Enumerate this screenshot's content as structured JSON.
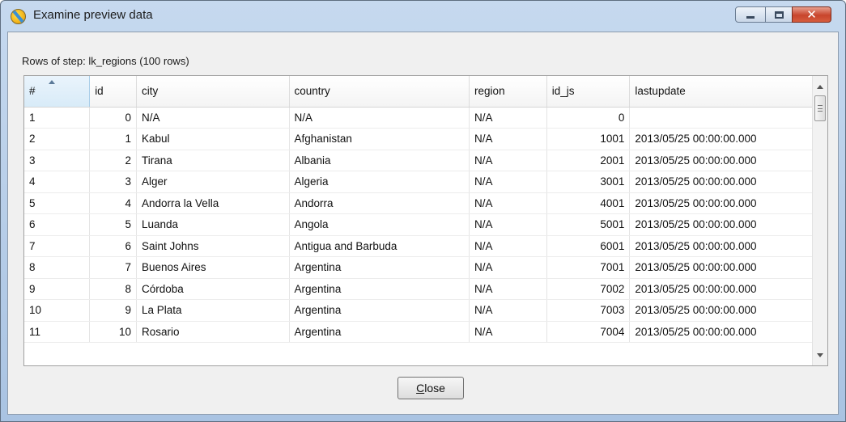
{
  "window": {
    "title": "Examine preview data",
    "icon": "app-icon"
  },
  "step_label": "Rows of step: lk_regions (100 rows)",
  "table": {
    "columns": [
      "#",
      "id",
      "city",
      "country",
      "region",
      "id_js",
      "lastupdate"
    ],
    "sorted_column": "#",
    "rows": [
      [
        "1",
        "0",
        "N/A",
        "N/A",
        "N/A",
        "0",
        ""
      ],
      [
        "2",
        "1",
        "Kabul",
        "Afghanistan",
        "N/A",
        "1001",
        "2013/05/25 00:00:00.000"
      ],
      [
        "3",
        "2",
        "Tirana",
        "Albania",
        "N/A",
        "2001",
        "2013/05/25 00:00:00.000"
      ],
      [
        "4",
        "3",
        "Alger",
        "Algeria",
        "N/A",
        "3001",
        "2013/05/25 00:00:00.000"
      ],
      [
        "5",
        "4",
        "Andorra la Vella",
        "Andorra",
        "N/A",
        "4001",
        "2013/05/25 00:00:00.000"
      ],
      [
        "6",
        "5",
        "Luanda",
        "Angola",
        "N/A",
        "5001",
        "2013/05/25 00:00:00.000"
      ],
      [
        "7",
        "6",
        "Saint Johns",
        "Antigua and Barbuda",
        "N/A",
        "6001",
        "2013/05/25 00:00:00.000"
      ],
      [
        "8",
        "7",
        "Buenos Aires",
        "Argentina",
        "N/A",
        "7001",
        "2013/05/25 00:00:00.000"
      ],
      [
        "9",
        "8",
        "Córdoba",
        "Argentina",
        "N/A",
        "7002",
        "2013/05/25 00:00:00.000"
      ],
      [
        "10",
        "9",
        "La Plata",
        "Argentina",
        "N/A",
        "7003",
        "2013/05/25 00:00:00.000"
      ],
      [
        "11",
        "10",
        "Rosario",
        "Argentina",
        "N/A",
        "7004",
        "2013/05/25 00:00:00.000"
      ]
    ]
  },
  "buttons": {
    "close_mnemonic": "C",
    "close_rest": "lose"
  },
  "colors": {
    "titlebar": "#c6d9ef",
    "close_button": "#c8452c",
    "sorted_header": "#d8ebf8"
  }
}
